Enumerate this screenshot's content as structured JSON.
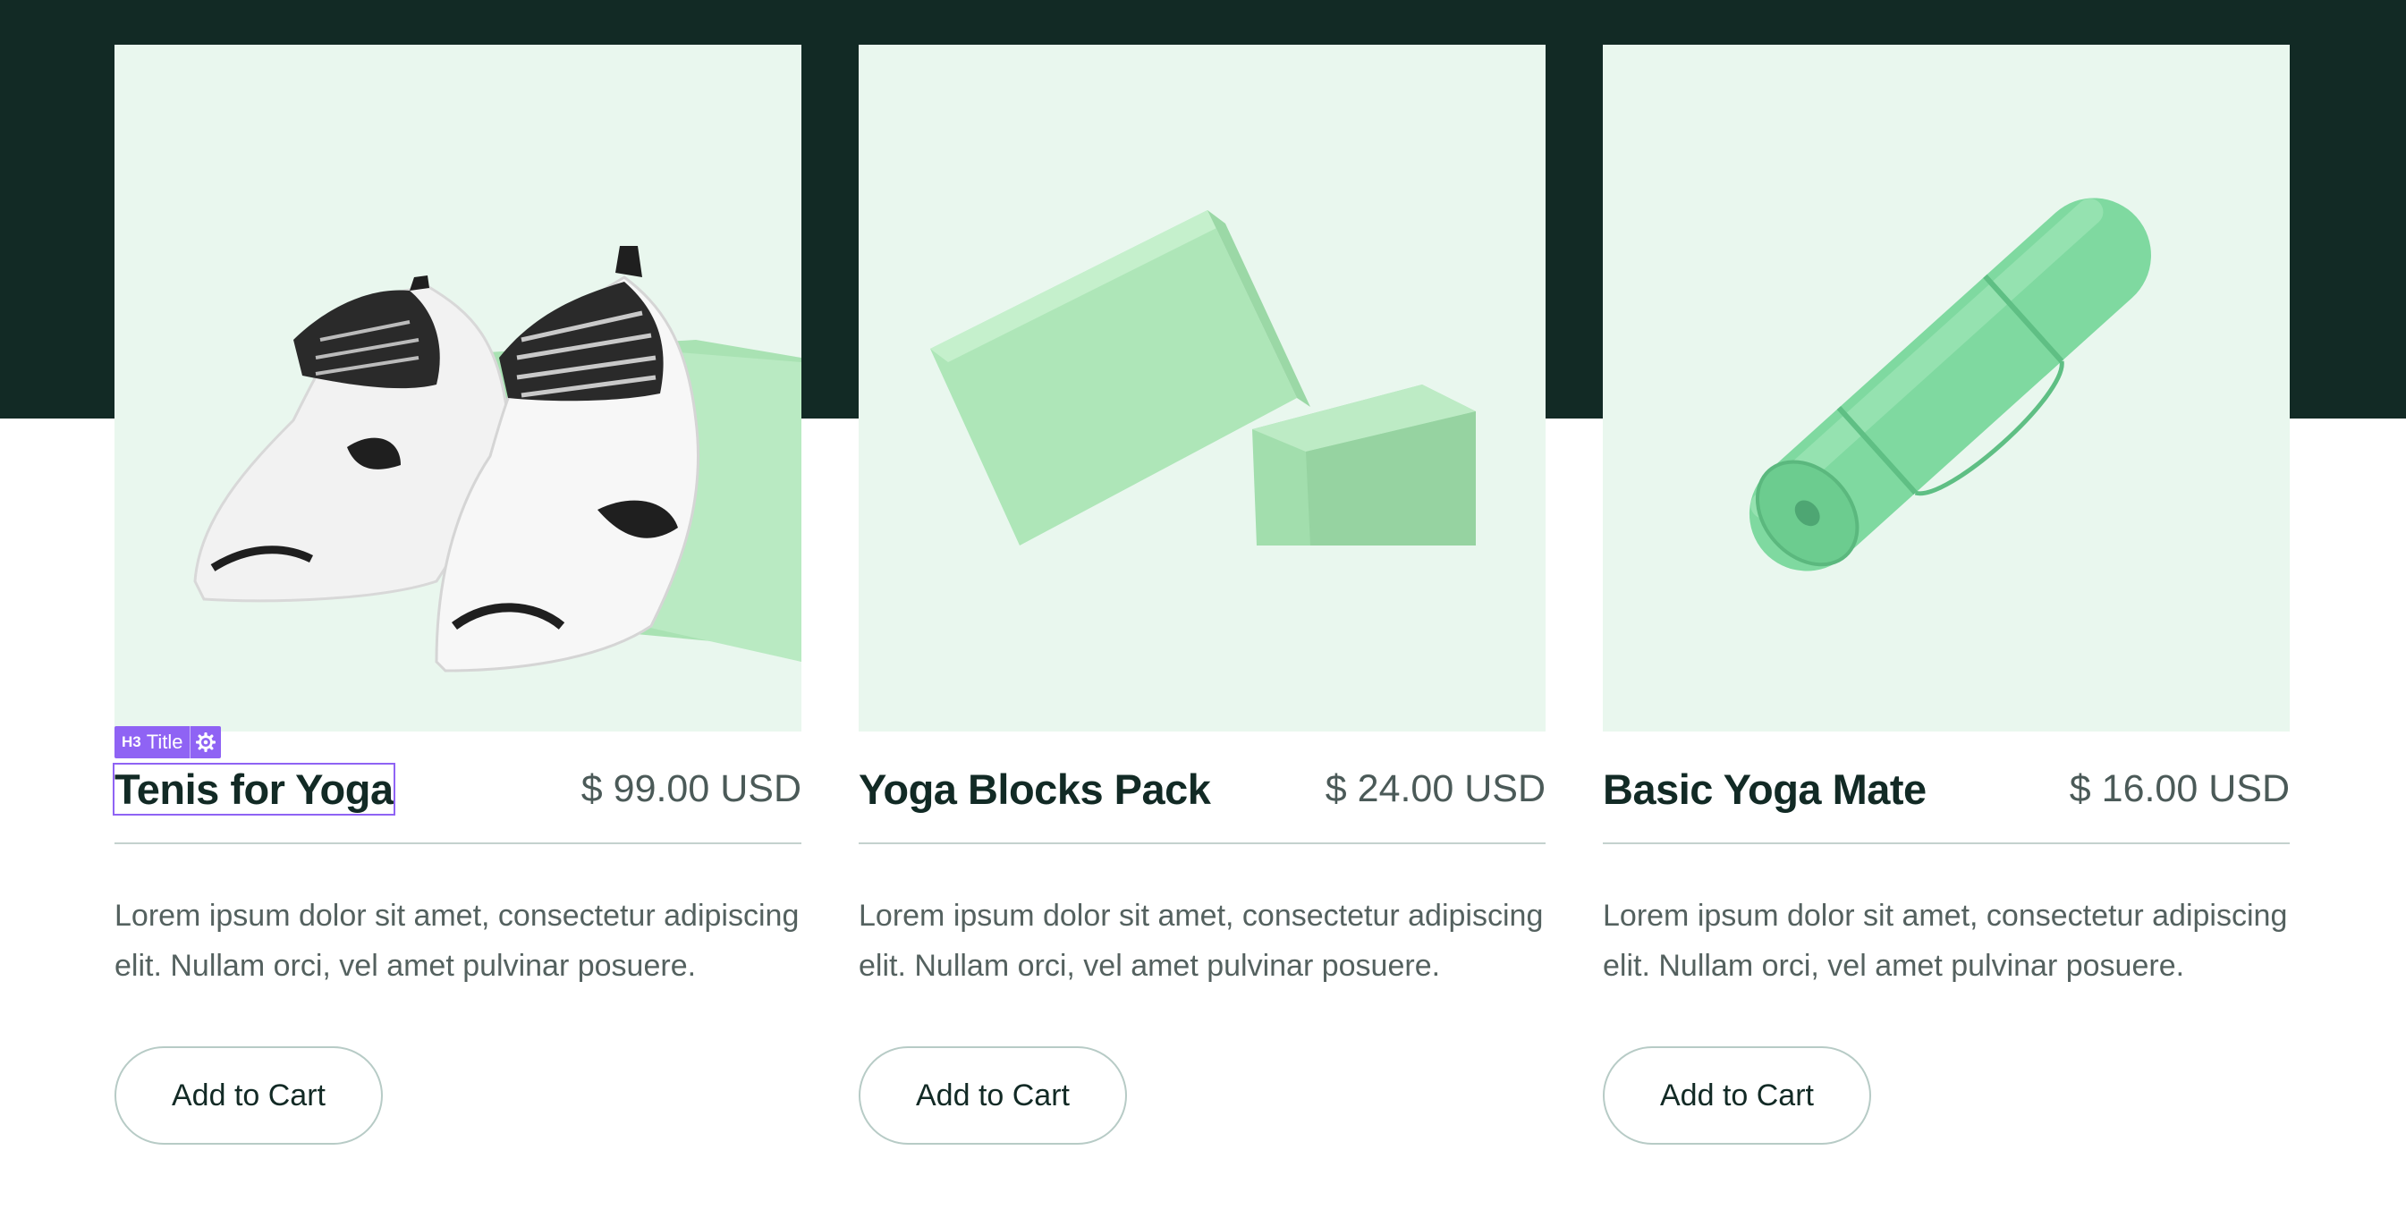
{
  "editor": {
    "selected_badge_tag": "H3",
    "selected_badge_label": "Title",
    "settings_icon": "gear-icon",
    "accent_color": "#8f63f4"
  },
  "theme": {
    "hero_background": "#122a25",
    "image_background": "#e9f7ee",
    "product_green": "#a8e6b5"
  },
  "products": [
    {
      "title": "Tenis for Yoga",
      "price": "$ 99.00 USD",
      "description": "Lorem ipsum dolor sit amet, consectetur adipiscing elit. Nullam orci, vel amet pulvinar posuere.",
      "button_label": "Add to Cart",
      "image": "yoga-sneakers-image"
    },
    {
      "title": "Yoga Blocks Pack",
      "price": "$ 24.00 USD",
      "description": "Lorem ipsum dolor sit amet, consectetur adipiscing elit. Nullam orci, vel amet pulvinar posuere.",
      "button_label": "Add to Cart",
      "image": "yoga-blocks-image"
    },
    {
      "title": "Basic Yoga Mate",
      "price": "$ 16.00 USD",
      "description": "Lorem ipsum dolor sit amet, consectetur adipiscing elit. Nullam orci, vel amet pulvinar posuere.",
      "button_label": "Add to Cart",
      "image": "rolled-yoga-mat-image"
    }
  ]
}
